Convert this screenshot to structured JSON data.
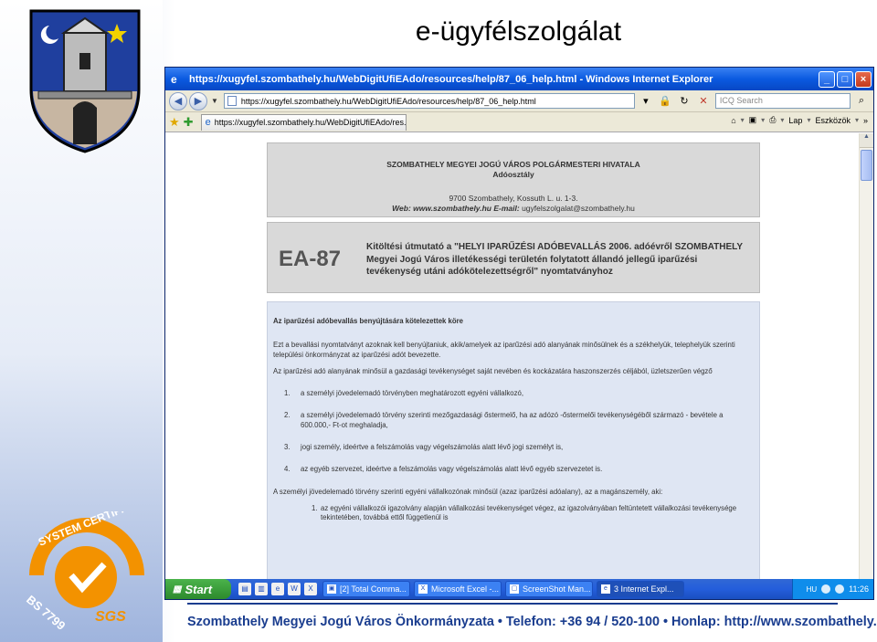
{
  "slide": {
    "title": "e-ügyfélszolgálat",
    "footer": "Szombathely Megyei Jogú Város Önkormányzata • Telefon: +36 94 / 520-100 • Honlap: http://www.szombathely.hu",
    "cert_text": "SYSTEM CERTIFICATION",
    "cert_code": "BS 7799",
    "cert_brand": "SGS",
    "colors": {
      "footer": "#1a3d8f",
      "xp_titlebar": "#0a5ae0"
    }
  },
  "browser": {
    "window_title": "https://xugyfel.szombathely.hu/WebDigitUfiEAdo/resources/help/87_06_help.html - Windows Internet Explorer",
    "address": "https://xugyfel.szombathely.hu/WebDigitUfiEAdo/resources/help/87_06_help.html",
    "search_placeholder": "ICQ Search",
    "tab_title": "https://xugyfel.szombathely.hu/WebDigitUfiEAdo/res...",
    "cmd_page": "Lap",
    "cmd_tools": "Eszközök"
  },
  "page": {
    "org_line1": "SZOMBATHELY MEGYEI JOGÚ VÁROS POLGÁRMESTERI HIVATALA",
    "org_line2": "Adóosztály",
    "org_address": "9700 Szombathely, Kossuth L. u. 1-3.",
    "org_web_label": "Web:",
    "org_web": "www.szombathely.hu",
    "org_email_label": "E-mail:",
    "org_email": "ugyfelszolgalat@szombathely.hu",
    "form_code": "EA-87",
    "form_desc": "Kitöltési útmutató a \"HELYI IPARŰZÉSI ADÓBEVALLÁS 2006. adóévről SZOMBATHELY Megyei Jogú Város illetékességi területén folytatott állandó jellegű iparűzési tevékenység utáni adókötelezettségről\" nyomtatványhoz",
    "section_heading": "Az iparűzési adóbevallás benyújtására kötelezettek köre",
    "p1": "Ezt a bevallási nyomtatványt azoknak kell benyújtaniuk, akik/amelyek az iparűzési adó alanyának minősülnek és a székhelyük, telephelyük szerinti települési önkormányzat az iparűzési adót bevezette.",
    "p2": "Az iparűzési adó alanyának minősül a gazdasági tevékenységet saját nevében és kockázatára haszonszerzés céljából, üzletszerűen végző",
    "items": [
      {
        "n": "1.",
        "text": "a személyi jövedelemadó törvényben meghatározott egyéni vállalkozó,"
      },
      {
        "n": "2.",
        "text": "a személyi jövedelemadó törvény szerinti mezőgazdasági őstermelő, ha az adózó -őstermelői tevékenységéből származó - bevétele a 600.000,- Ft-ot meghaladja,"
      },
      {
        "n": "3.",
        "text": "jogi személy, ideértve a felszámolás vagy végelszámolás alatt lévő jogi személyt is,"
      },
      {
        "n": "4.",
        "text": "az egyéb szervezet, ideértve a felszámolás vagy végelszámolás alatt lévő egyéb szervezetet is."
      }
    ],
    "p3": "A személyi jövedelemadó törvény szerinti egyéni vállalkozónak minősül (azaz iparűzési adóalany), az a magánszemély, aki:",
    "sub_items": [
      {
        "n": "1.",
        "text": "az egyéni vállalkozói igazolvány alapján vállalkozási tevékenységet végez, az igazolványában feltüntetett vállalkozási tevékenysége tekintetében, továbbá ettől függetlenül is"
      }
    ]
  },
  "taskbar": {
    "start": "Start",
    "tasks": [
      {
        "label": "[2] Total Comma...",
        "active": false
      },
      {
        "label": "Microsoft Excel -...",
        "active": false
      },
      {
        "label": "ScreenShot Man...",
        "active": false
      },
      {
        "label": "3 Internet Expl...",
        "active": true
      }
    ],
    "lang": "HU",
    "clock": "11:26"
  }
}
